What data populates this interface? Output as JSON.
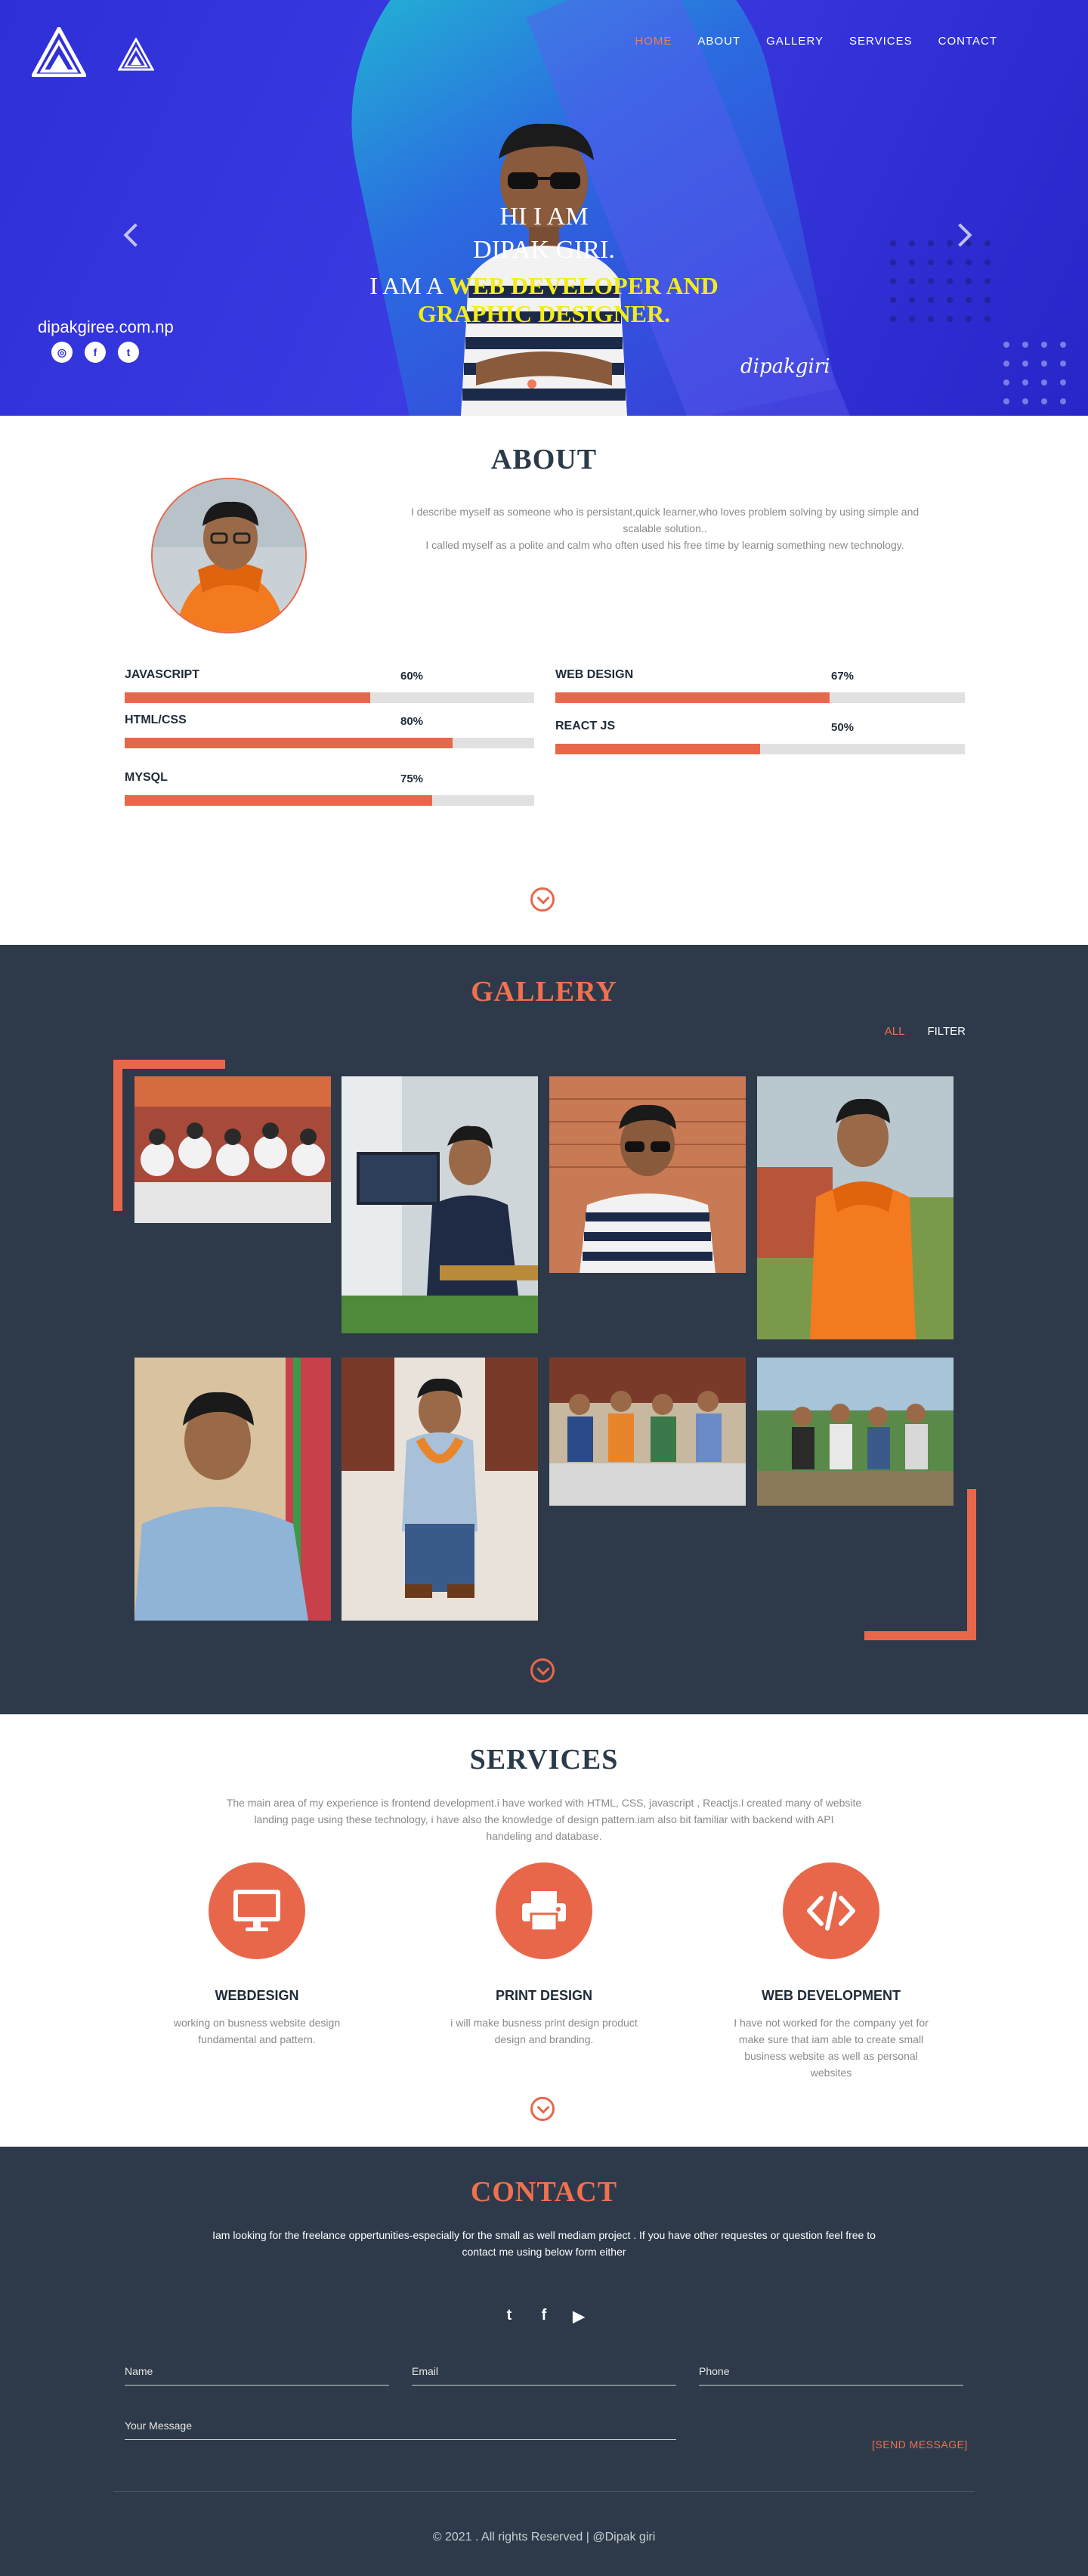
{
  "nav": {
    "items": [
      {
        "label": "HOME",
        "active": true
      },
      {
        "label": "ABOUT",
        "active": false
      },
      {
        "label": "GALLERY",
        "active": false
      },
      {
        "label": "SERVICES",
        "active": false
      },
      {
        "label": "CONTACT",
        "active": false
      }
    ]
  },
  "hero": {
    "line1": "HI I AM",
    "line2": "DIPAK GIRI.",
    "line3_prefix": "I AM A ",
    "line3_highlight_a": "WEB DEVELOPER AND",
    "line3_highlight_b": "GRAPHIC DESIGNER.",
    "domain": "dipakgiree.com.np",
    "signature": "dipakgiri",
    "social_icons": [
      "instagram-icon",
      "facebook-icon",
      "twitter-icon"
    ],
    "social_glyphs": [
      "◎",
      "f",
      "t"
    ]
  },
  "about": {
    "title": "ABOUT",
    "desc_line1": "I describe myself as someone who is persistant,quick learner,who loves problem solving by using simple and",
    "desc_line2": "scalable solution..",
    "desc_line3": "I called myself as a polite and calm who often used his free time by learnig something new technology.",
    "skills": [
      {
        "name": "JAVASCRIPT",
        "percent_label": "60%",
        "percent": 60
      },
      {
        "name": "WEB DESIGN",
        "percent_label": "67%",
        "percent": 67
      },
      {
        "name": "HTML/CSS",
        "percent_label": "80%",
        "percent": 80
      },
      {
        "name": "REACT JS",
        "percent_label": "50%",
        "percent": 50
      },
      {
        "name": "MYSQL",
        "percent_label": "75%",
        "percent": 75
      }
    ]
  },
  "gallery": {
    "title": "GALLERY",
    "filter_all": "ALL",
    "filter_label": "FILTER"
  },
  "services": {
    "title": "SERVICES",
    "desc_line1": "The main area of my experience is frontend development.i have worked with HTML, CSS, javascript , Reactjs.I created many of website",
    "desc_line2": "landing page using these technology, i have also the knowledge of design pattern.iam also bit familiar with backend with API",
    "desc_line3": "handeling and database.",
    "items": [
      {
        "title": "WEBDESIGN",
        "icon": "monitor-icon",
        "desc": "working on busness website design fundamental and pattern."
      },
      {
        "title": "PRINT DESIGN",
        "icon": "printer-icon",
        "desc": "i will make busness print design product design and branding."
      },
      {
        "title": "WEB DEVELOPMENT",
        "icon": "code-icon",
        "desc": "I have not worked for the company yet for make sure that iam able to create small business website as well as personal websites"
      }
    ]
  },
  "contact": {
    "title": "CONTACT",
    "desc_line1": "Iam looking for the freelance oppertunities-especially for the small as well mediam project . If you have other requestes or question feel free to",
    "desc_line2": "contact me using below form either",
    "social_icons": [
      "twitter-icon",
      "facebook-icon",
      "youtube-icon"
    ],
    "social_glyphs": [
      "t",
      "f",
      "▶"
    ],
    "name_placeholder": "Name",
    "email_placeholder": "Email",
    "phone_placeholder": "Phone",
    "message_placeholder": "Your Message",
    "send_label": "[SEND MESSAGE]",
    "copyright": "© 2021 . All rights Reserved | @Dipak giri"
  },
  "colors": {
    "accent": "#e8674a",
    "dark": "#2e3a4a",
    "hero_blue": "#2f2fd8",
    "highlight": "#f4ec1a"
  }
}
